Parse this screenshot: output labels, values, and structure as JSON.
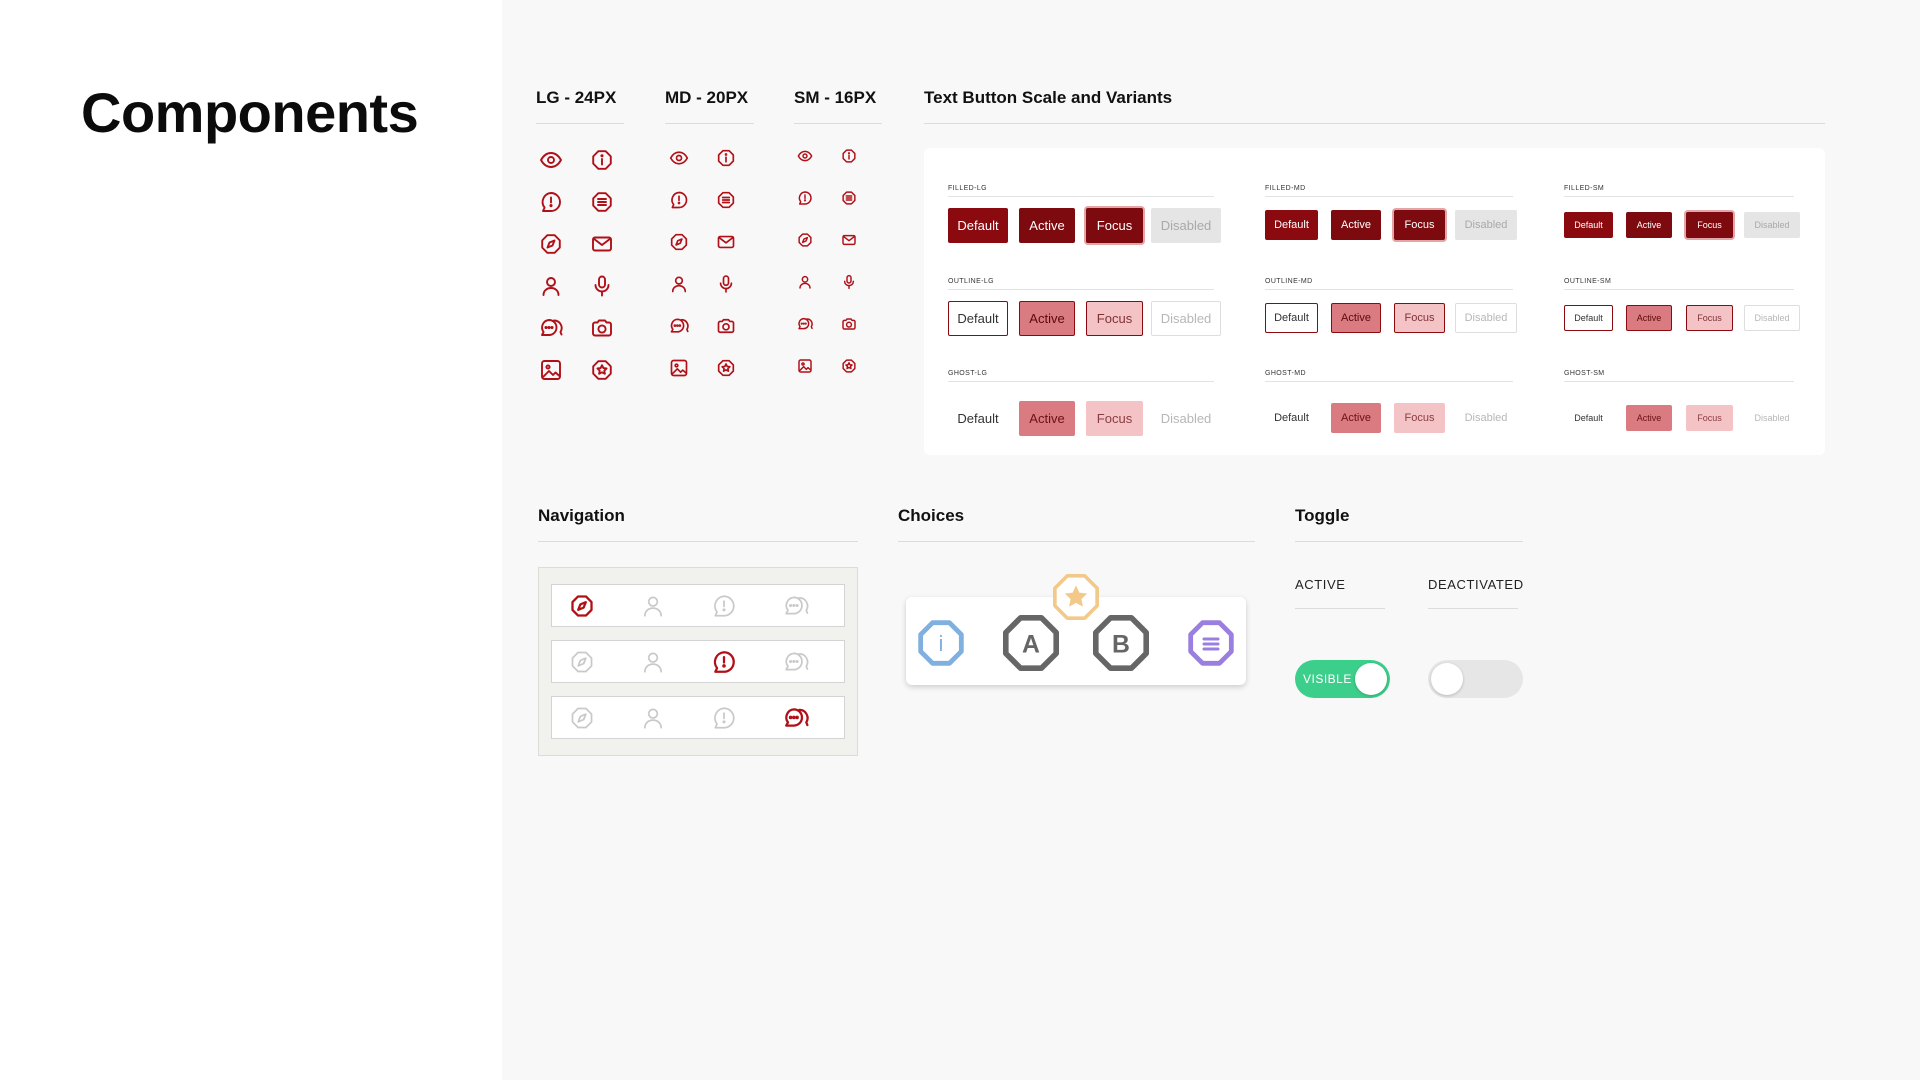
{
  "page": {
    "title": "Components"
  },
  "icons": {
    "sections": [
      {
        "title": "LG - 24PX"
      },
      {
        "title": "MD - 20PX"
      },
      {
        "title": "SM - 16PX"
      }
    ],
    "rows": [
      [
        "eye-icon",
        "info-icon"
      ],
      [
        "alert-message-icon",
        "list-icon"
      ],
      [
        "compass-icon",
        "mail-icon"
      ],
      [
        "user-icon",
        "microphone-icon"
      ],
      [
        "chat-icon",
        "camera-icon"
      ],
      [
        "image-icon",
        "star-badge-icon"
      ]
    ],
    "color": "#b01017"
  },
  "text_buttons": {
    "title": "Text Button Scale and Variants",
    "groups": [
      {
        "label": "FILLED-LG",
        "buttons": [
          "Default",
          "Active",
          "Focus",
          "Disabled"
        ]
      },
      {
        "label": "FILLED-MD",
        "buttons": [
          "Default",
          "Active",
          "Focus",
          "Disabled"
        ]
      },
      {
        "label": "FILLED-SM",
        "buttons": [
          "Default",
          "Active",
          "Focus",
          "Disabled"
        ]
      },
      {
        "label": "OUTLINE-LG",
        "buttons": [
          "Default",
          "Active",
          "Focus",
          "Disabled"
        ]
      },
      {
        "label": "OUTLINE-MD",
        "buttons": [
          "Default",
          "Active",
          "Focus",
          "Disabled"
        ]
      },
      {
        "label": "OUTLINE-SM",
        "buttons": [
          "Default",
          "Active",
          "Focus",
          "Disabled"
        ]
      },
      {
        "label": "GHOST-LG",
        "buttons": [
          "Default",
          "Active",
          "Focus",
          "Disabled"
        ]
      },
      {
        "label": "GHOST-MD",
        "buttons": [
          "Default",
          "Active",
          "Focus",
          "Disabled"
        ]
      },
      {
        "label": "GHOST-SM",
        "buttons": [
          "Default",
          "Active",
          "Focus",
          "Disabled"
        ]
      }
    ],
    "colors": {
      "primary": "#8b0a10",
      "active_tint": "#d97b81",
      "focus_tint": "#f4c3c5",
      "disabled": "#e5e5e6"
    }
  },
  "navigation": {
    "title": "Navigation",
    "icons": [
      "compass-icon",
      "user-icon",
      "alert-message-icon",
      "chat-icon"
    ],
    "active_index_per_row": [
      0,
      2,
      3
    ],
    "active_color": "#b01017",
    "inactive_color": "#c9c9c9"
  },
  "choices": {
    "title": "Choices",
    "items": [
      {
        "name": "info-choice",
        "glyph": "i",
        "color": "#7fb0e0"
      },
      {
        "name": "choice-a",
        "glyph": "A",
        "color": "#666666"
      },
      {
        "name": "choice-b",
        "glyph": "B",
        "color": "#666666"
      },
      {
        "name": "list-choice",
        "glyph": "≡",
        "color": "#9b7fe0"
      }
    ],
    "floating": {
      "name": "star-choice",
      "color": "#f2c988"
    }
  },
  "toggle": {
    "title": "Toggle",
    "active_label": "ACTIVE",
    "deactivated_label": "DEACTIVATED",
    "on_text": "VISIBLE",
    "on_color": "#3ccf8b",
    "off_color": "#e6e6e7"
  }
}
